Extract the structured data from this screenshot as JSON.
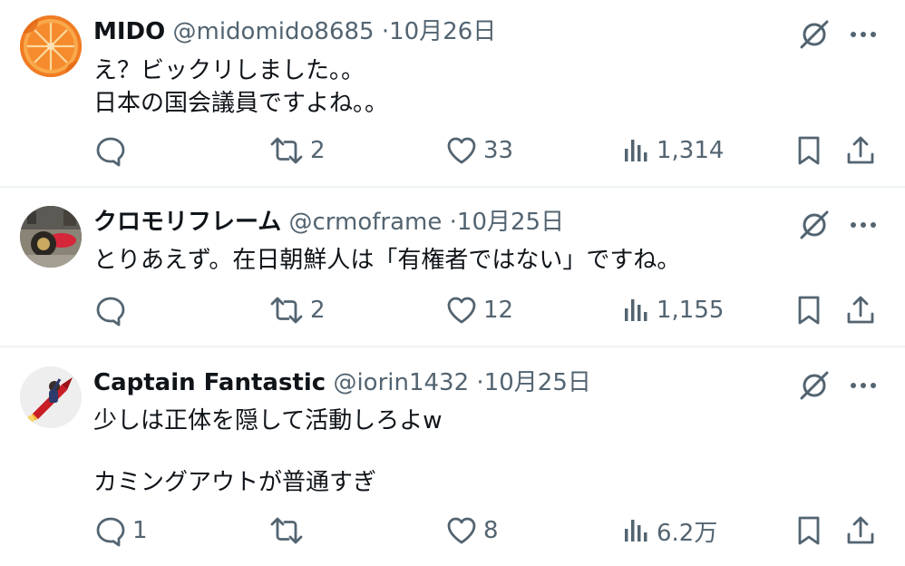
{
  "tweets": [
    {
      "name": "MIDO",
      "handle": "@midomido8685",
      "separator": "·",
      "date": "10月26日",
      "text": "え？ビックリしました。。\n日本の国会議員ですよね。。",
      "avatar_icon": "orange-slice-avatar",
      "replies": "",
      "retweets": "2",
      "likes": "33",
      "views": "1,314"
    },
    {
      "name": "クロモリフレーム",
      "handle": "@crmoframe",
      "separator": "·",
      "date": "10月25日",
      "text": "とりあえず。在日朝鮮人は「有権者ではない」ですね。",
      "avatar_icon": "photo-avatar",
      "replies": "",
      "retweets": "2",
      "likes": "12",
      "views": "1,155"
    },
    {
      "name": "Captain Fantastic",
      "handle": "@iorin1432",
      "separator": "·",
      "date": "10月25日",
      "text": "少しは正体を隠して活動しろよw\n\nカミングアウトが普通すぎ",
      "avatar_icon": "rocket-rider-avatar",
      "replies": "1",
      "retweets": "",
      "likes": "8",
      "views": "6.2万"
    }
  ],
  "colors": {
    "text": "#0f1419",
    "secondary": "#536471",
    "divider": "#eff3f4"
  }
}
